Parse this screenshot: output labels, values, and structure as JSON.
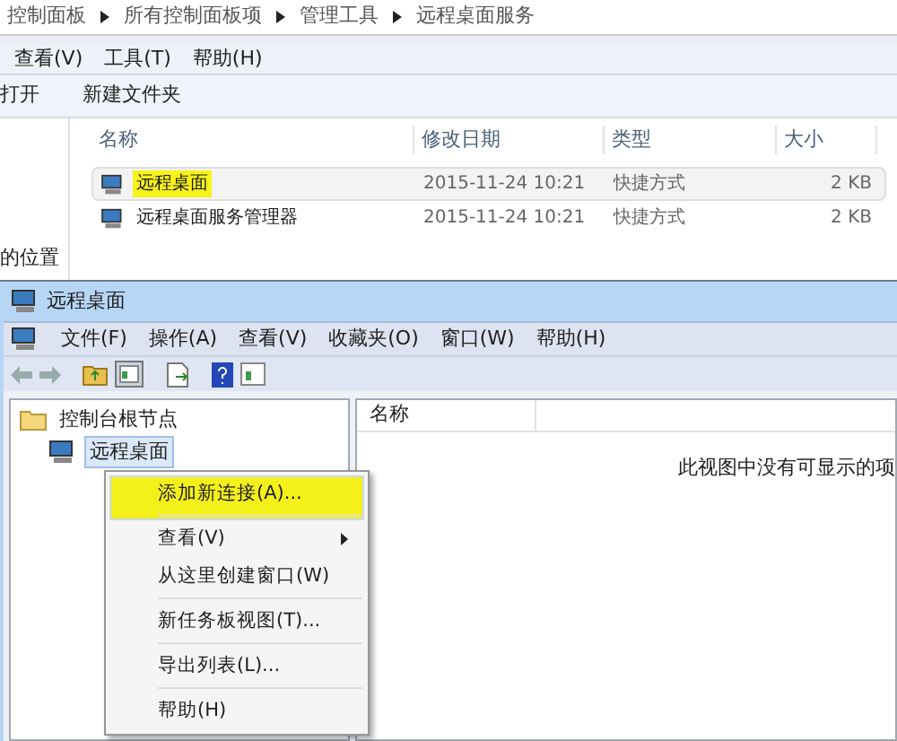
{
  "explorer": {
    "breadcrumb": [
      "控制面板",
      "所有控制面板项",
      "管理工具",
      "远程桌面服务"
    ],
    "menu": [
      "查看(V)",
      "工具(T)",
      "帮助(H)"
    ],
    "toolbar": [
      "打开",
      "新建文件夹"
    ],
    "nav_text": "的位置",
    "columns": [
      "名称",
      "修改日期",
      "类型",
      "大小"
    ],
    "rows": [
      {
        "name": "远程桌面",
        "date": "2015-11-24 10:21",
        "type": "快捷方式",
        "size": "2 KB",
        "highlighted": true
      },
      {
        "name": "远程桌面服务管理器",
        "date": "2015-11-24 10:21",
        "type": "快捷方式",
        "size": "2 KB",
        "highlighted": false
      }
    ]
  },
  "mmc": {
    "title": "远程桌面",
    "menu": [
      "文件(F)",
      "操作(A)",
      "查看(V)",
      "收藏夹(O)",
      "窗口(W)",
      "帮助(H)"
    ],
    "tree": [
      {
        "label": "控制台根节点",
        "selected": false,
        "children": [
          {
            "label": "远程桌面",
            "selected": true
          }
        ]
      }
    ],
    "column": "名称",
    "empty_message": "此视图中没有可显示的项",
    "context_menu": [
      {
        "label": "添加新连接(A)...",
        "highlighted": true,
        "submenu": false,
        "separator_after": true
      },
      {
        "label": "查看(V)",
        "highlighted": false,
        "submenu": true,
        "separator_after": false
      },
      {
        "label": "从这里创建窗口(W)",
        "highlighted": false,
        "submenu": false,
        "separator_after": true
      },
      {
        "label": "新任务板视图(T)...",
        "highlighted": false,
        "submenu": false,
        "separator_after": true
      },
      {
        "label": "导出列表(L)...",
        "highlighted": false,
        "submenu": false,
        "separator_after": true
      },
      {
        "label": "帮助(H)",
        "highlighted": false,
        "submenu": false,
        "separator_after": false
      }
    ]
  }
}
